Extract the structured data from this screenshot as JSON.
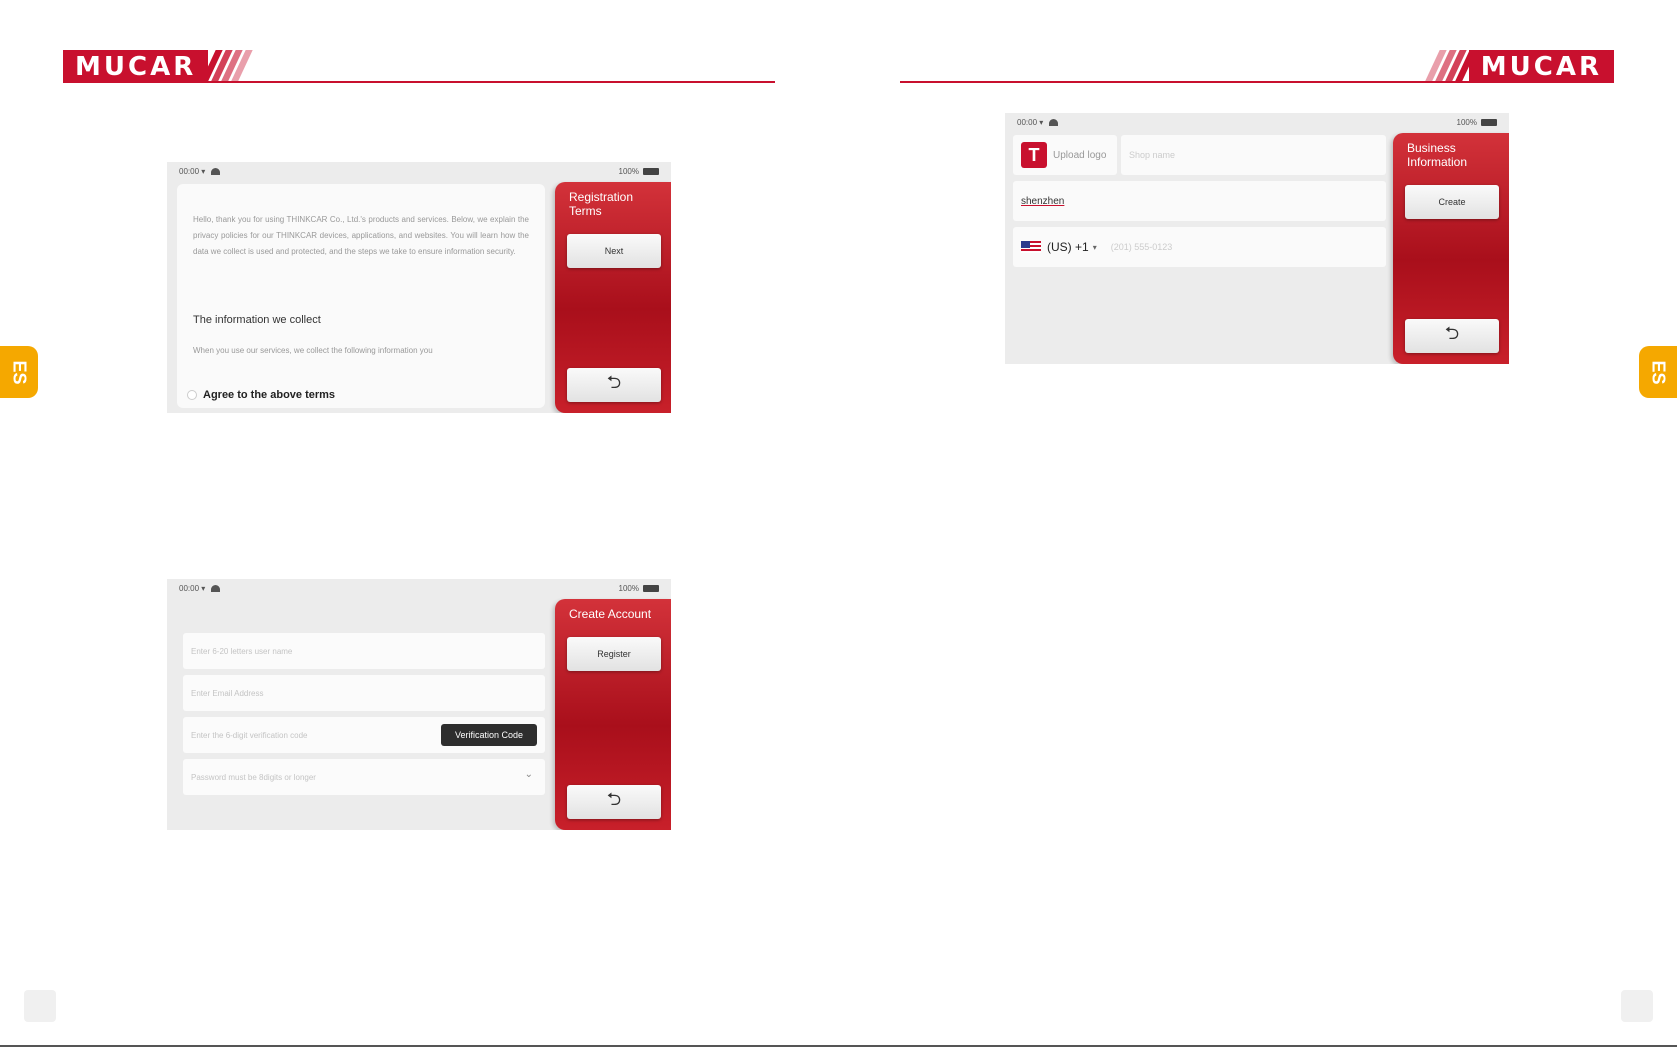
{
  "brand": {
    "left": "MUCAR",
    "right": "MUCAR",
    "accent": "#c8102e"
  },
  "side_tab": {
    "left": "ES",
    "right": "ES",
    "color": "#f5a800"
  },
  "screens": {
    "registration": {
      "status_time": "00:00 ▾",
      "status_battery": "100%",
      "terms_paragraph": "Hello, thank you for using THINKCAR Co., Ltd.'s products and services. Below, we explain the privacy policies for our THINKCAR devices, applications, and websites. You will learn how the data we collect is used and protected, and the steps we take to ensure information security.",
      "terms_heading": "The information we collect",
      "terms_more": "When you use our services, we collect the following information you",
      "agree_label": "Agree to the above terms",
      "panel_title": "Registration Terms",
      "next_label": "Next",
      "back_icon": "back-arrow"
    },
    "create_account": {
      "status_time": "00:00 ▾",
      "status_battery": "100%",
      "username_placeholder": "Enter 6-20 letters user name",
      "email_placeholder": "Enter Email Address",
      "code_placeholder": "Enter the 6-digit verification code",
      "verify_label": "Verification Code",
      "password_placeholder": "Password must be 8digits or longer",
      "panel_title": "Create Account",
      "register_label": "Register",
      "back_icon": "back-arrow"
    },
    "business": {
      "status_time": "00:00 ▾",
      "status_battery": "100%",
      "upload_logo": "Upload logo",
      "shop_placeholder": "Shop name",
      "city": "shenzhen",
      "country_code": "(US) +1",
      "phone_placeholder": "(201) 555-0123",
      "panel_title": "Business Information",
      "create_label": "Create",
      "back_icon": "back-arrow"
    }
  }
}
